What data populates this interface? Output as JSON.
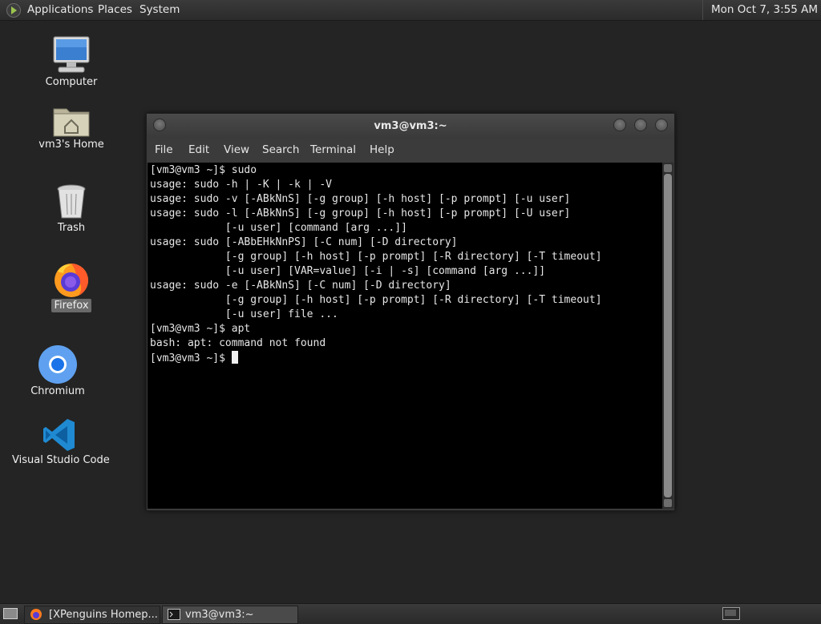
{
  "top_panel": {
    "menus": [
      "Applications",
      "Places",
      "System"
    ],
    "clock": "Mon Oct  7,  3:55 AM"
  },
  "desktop": {
    "icons": [
      {
        "label": "Computer",
        "icon": "computer-icon"
      },
      {
        "label": "vm3's Home",
        "icon": "home-folder-icon"
      },
      {
        "label": "Trash",
        "icon": "trash-icon"
      },
      {
        "label": "Firefox",
        "icon": "firefox-icon",
        "selected": true
      },
      {
        "label": "Chromium",
        "icon": "chromium-icon"
      },
      {
        "label": "Visual Studio Code",
        "icon": "vscode-icon"
      }
    ]
  },
  "terminal": {
    "title": "vm3@vm3:~",
    "menu": [
      "File",
      "Edit",
      "View",
      "Search",
      "Terminal",
      "Help"
    ],
    "lines": [
      "[vm3@vm3 ~]$ sudo",
      "usage: sudo -h | -K | -k | -V",
      "usage: sudo -v [-ABkNnS] [-g group] [-h host] [-p prompt] [-u user]",
      "usage: sudo -l [-ABkNnS] [-g group] [-h host] [-p prompt] [-U user]",
      "            [-u user] [command [arg ...]]",
      "usage: sudo [-ABbEHkNnPS] [-C num] [-D directory]",
      "            [-g group] [-h host] [-p prompt] [-R directory] [-T timeout]",
      "            [-u user] [VAR=value] [-i | -s] [command [arg ...]]",
      "usage: sudo -e [-ABkNnS] [-C num] [-D directory]",
      "            [-g group] [-h host] [-p prompt] [-R directory] [-T timeout]",
      "            [-u user] file ...",
      "[vm3@vm3 ~]$ apt",
      "bash: apt: command not found"
    ],
    "prompt": "[vm3@vm3 ~]$ "
  },
  "taskbar": {
    "tasks": [
      {
        "label": "[XPenguins Homep...",
        "icon": "firefox-icon",
        "active": false
      },
      {
        "label": "vm3@vm3:~",
        "icon": "terminal-icon",
        "active": true
      }
    ]
  }
}
